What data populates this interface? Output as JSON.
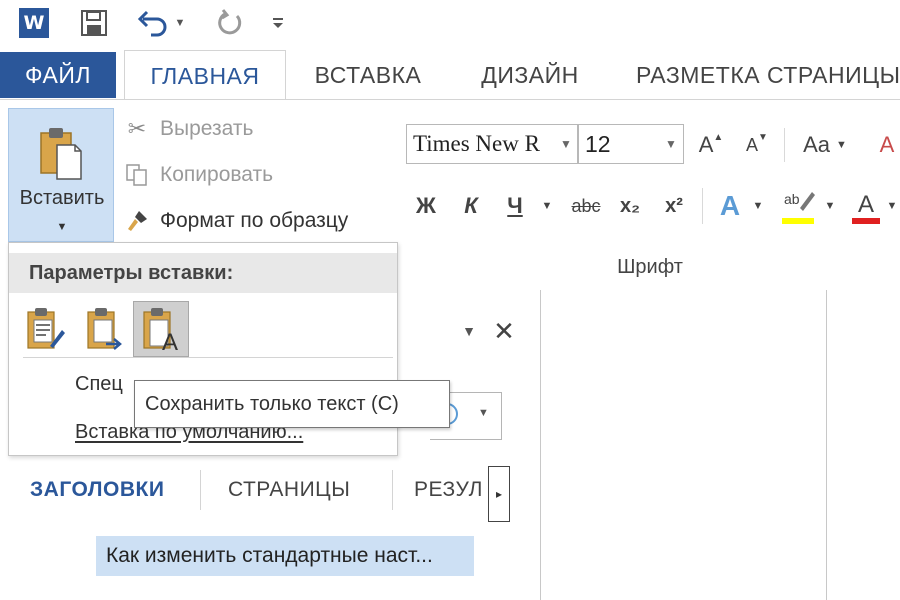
{
  "app": {
    "logo_letter": "W"
  },
  "tabs": {
    "file": "ФАЙЛ",
    "home": "ГЛАВНАЯ",
    "insert": "ВСТАВКА",
    "design": "ДИЗАЙН",
    "layout": "РАЗМЕТКА СТРАНИЦЫ"
  },
  "clipboard": {
    "paste_label": "Вставить",
    "cut_label": "Вырезать",
    "copy_label": "Копировать",
    "format_painter_label": "Формат по образцу"
  },
  "font": {
    "name": "Times New R",
    "size": "12",
    "grow": "A",
    "shrink": "A",
    "case": "Aa",
    "bold": "Ж",
    "italic": "К",
    "underline": "Ч",
    "strike": "abc",
    "subscript": "x₂",
    "superscript": "x²",
    "effects": "A",
    "group_label": "Шрифт"
  },
  "paste_menu": {
    "header": "Параметры вставки:",
    "special": "Спец",
    "default": "Вставка по умолчанию..."
  },
  "tooltip": {
    "text": "Сохранить только текст (С)"
  },
  "nav_pane": {
    "tabs": [
      "ЗАГОЛОВКИ",
      "СТРАНИЦЫ",
      "РЕЗУЛ"
    ],
    "heading_item": "Как изменить стандартные наст..."
  },
  "colors": {
    "accent": "#2b579a",
    "selection": "#cde0f4",
    "highlight_yellow": "#ffff00",
    "font_red": "#e02020"
  }
}
